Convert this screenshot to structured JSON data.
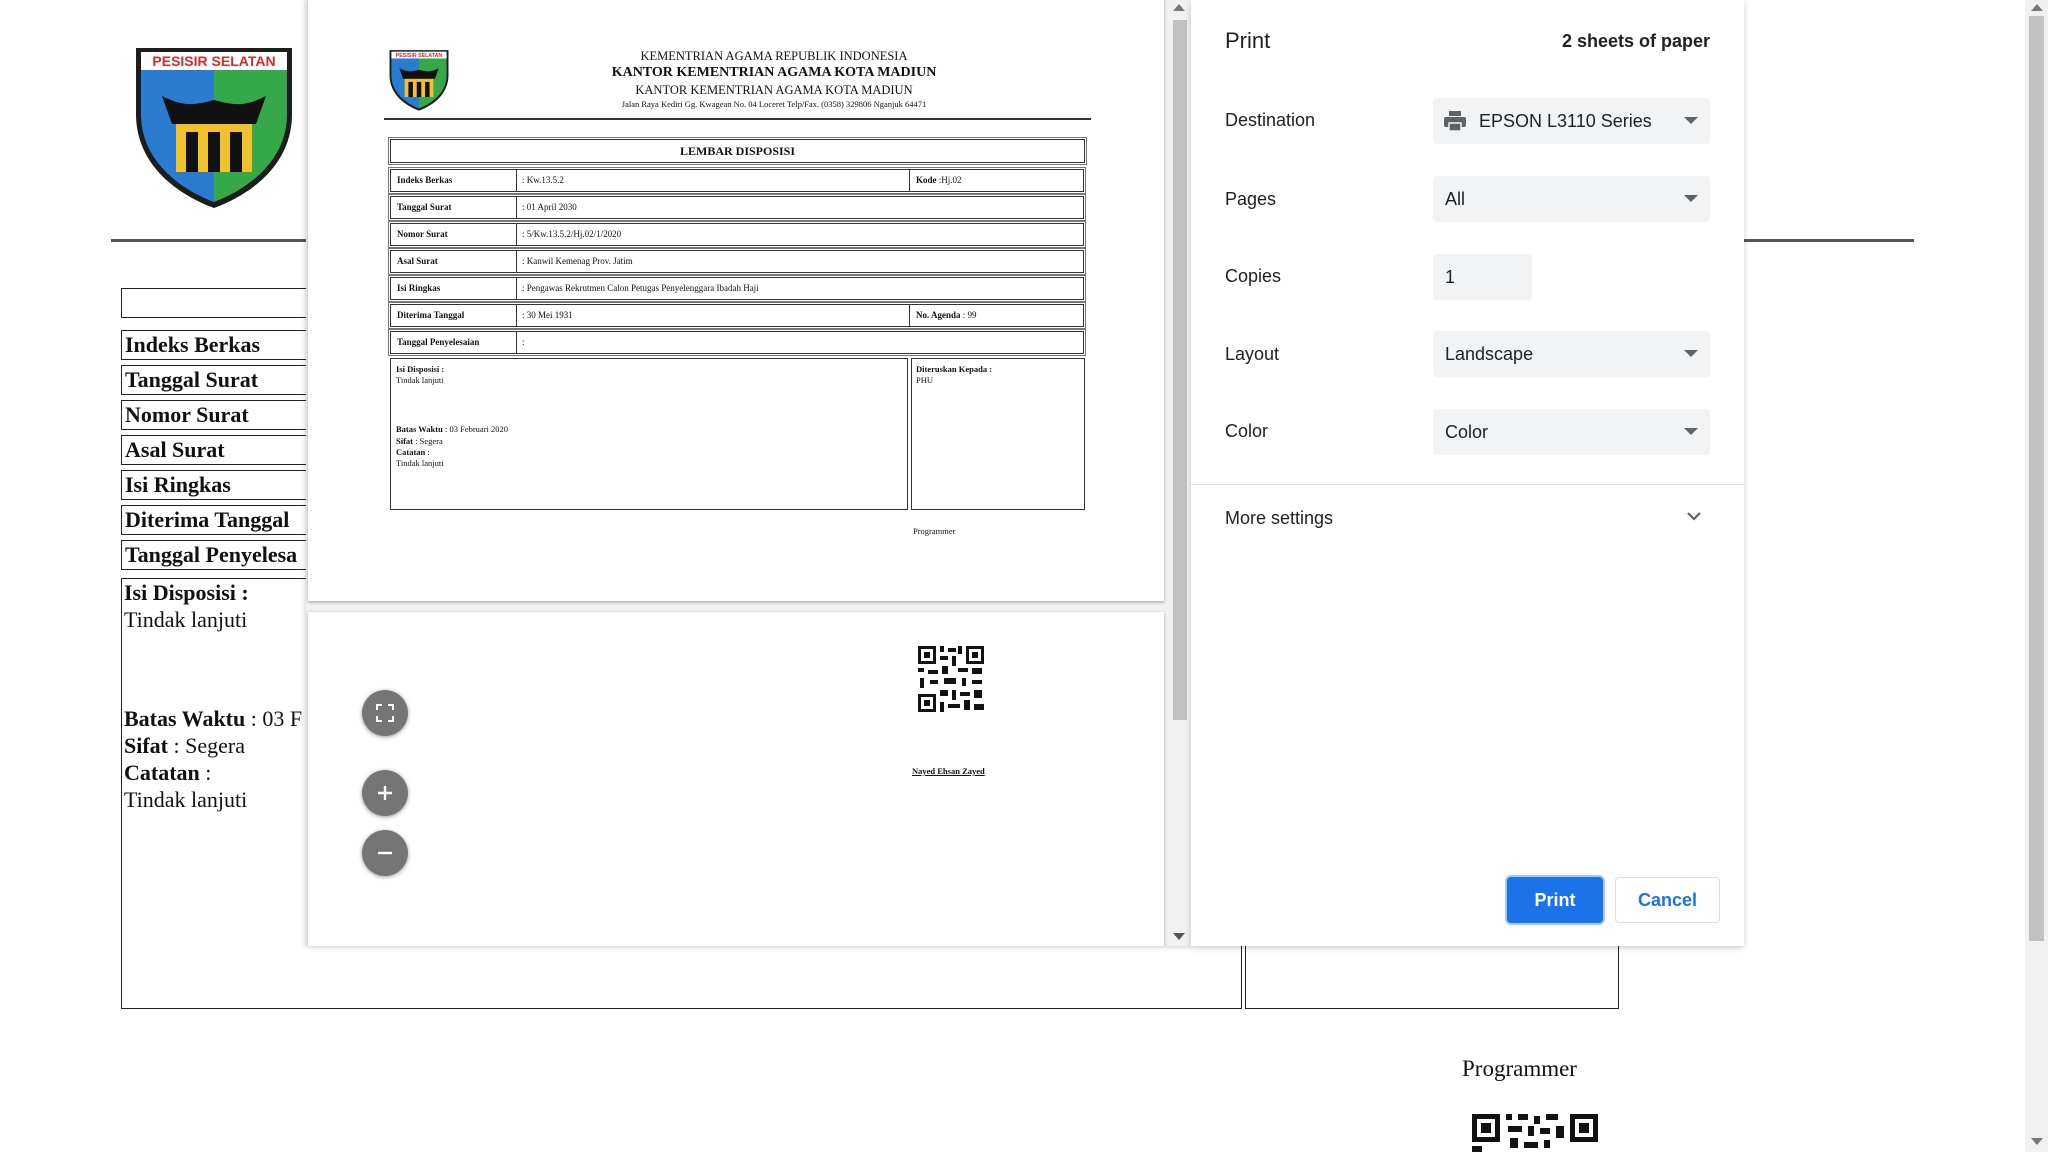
{
  "background": {
    "logo_text": "PESISIR SELATAN",
    "rows": [
      "Indeks Berkas",
      "Tanggal Surat",
      "Nomor Surat",
      "Asal Surat",
      "Isi Ringkas",
      "Diterima Tanggal",
      "Tanggal Penyelesa"
    ],
    "isi_disposisi_label": "Isi Disposisi :",
    "isi_disposisi_value": "Tindak lanjuti",
    "batas_waktu_label": "Batas Waktu",
    "batas_waktu_value": ": 03 F",
    "sifat_label": "Sifat",
    "sifat_value": ": Segera",
    "catatan_label": "Catatan",
    "catatan_value": ":",
    "catatan_text": "Tindak lanjuti",
    "programmer": "Programmer"
  },
  "preview": {
    "header_line1": "KEMENTRIAN AGAMA REPUBLIK INDONESIA",
    "header_line2": "KANTOR KEMENTRIAN AGAMA KOTA MADIUN",
    "header_line3": "KANTOR KEMENTRIAN AGAMA KOTA MADIUN",
    "header_line4": "Jalan Raya Kediri Gg. Kwagean No. 04 Loceret Telp/Fax. (0358) 329806 Nganjuk 64471",
    "title": "LEMBAR DISPOSISI",
    "rows": [
      {
        "label": "Indeks Berkas",
        "value": ": Kw.13.5.2",
        "extra_label": "Kode",
        "extra_value": ":Hj.02"
      },
      {
        "label": "Tanggal Surat",
        "value": ": 01 April 2030"
      },
      {
        "label": "Nomor Surat",
        "value": ": 5/Kw.13.5.2/Hj.02/1/2020"
      },
      {
        "label": "Asal Surat",
        "value": ": Kanwil Kemenag Prov. Jatim"
      },
      {
        "label": "Isi Ringkas",
        "value": ": Pengawas Rekrutmen Calon Petugas Penyelenggara Ibadah Haji"
      },
      {
        "label": "Diterima Tanggal",
        "value": ": 30 Mei 1931",
        "extra_label": "No. Agenda",
        "extra_value": ": 99"
      },
      {
        "label": "Tanggal Penyelesaian",
        "value": ":"
      }
    ],
    "isi_disposisi_label": "Isi Disposisi :",
    "isi_disposisi_value": "Tindak lanjuti",
    "batas_waktu_label": "Batas Waktu",
    "batas_waktu_value": ": 03 Februari 2020",
    "sifat_label": "Sifat",
    "sifat_value": ": Segera",
    "catatan_label": "Catatan",
    "catatan_value": ":",
    "catatan_text": "Tindak lanjuti",
    "diteruskan_label": "Diteruskan Kepada :",
    "diteruskan_value": "PHU",
    "programmer": "Programmer",
    "signature_name": "Nayed Ehsan Zayed"
  },
  "zoom": {
    "fit_icon": "fit-to-page-icon",
    "zoom_in_icon": "zoom-in-icon",
    "zoom_out_icon": "zoom-out-icon"
  },
  "print_panel": {
    "title": "Print",
    "sheets": "2 sheets of paper",
    "destination_label": "Destination",
    "destination_value": "EPSON L3110 Series",
    "pages_label": "Pages",
    "pages_value": "All",
    "copies_label": "Copies",
    "copies_value": "1",
    "layout_label": "Layout",
    "layout_value": "Landscape",
    "color_label": "Color",
    "color_value": "Color",
    "more_settings": "More settings",
    "print_button": "Print",
    "cancel_button": "Cancel",
    "accent_color": "#1a73e8"
  }
}
